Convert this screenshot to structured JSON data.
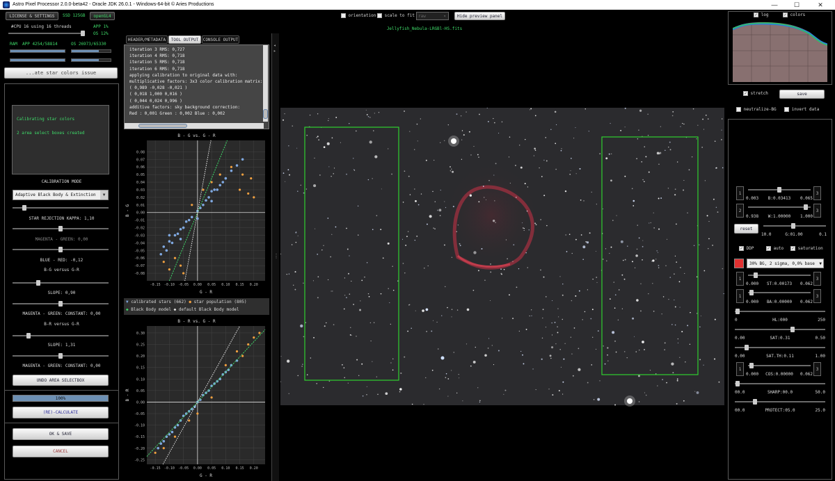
{
  "window": {
    "title": "Astro Pixel Processor 2.0.0-beta42 - Oracle JDK 26.0.1 - Windows-64-bit © Aries Productions"
  },
  "top_left": {
    "license_button": "LICENSE & SETTINGS",
    "ssd": "SSD 125GB",
    "opengl": "openGL4",
    "cpu_text": "#CPU 16  using 16 threads",
    "app_pct": "APP 1%",
    "os_pct": "OS 12%",
    "ram_label": "RAM",
    "ram_app": "APP 4254/58814",
    "ram_os": "OS 26973/65330",
    "task_button": "...ate star colors issue"
  },
  "left_panel": {
    "message_lines": [
      "Calibrating star colors",
      "2 area select boxes created"
    ],
    "calibration_mode_label": "CALIBRATION MODE",
    "calibration_mode_value": "Adaptive Black Body & Extinction",
    "star_rejection": "STAR REJECTION KAPPA: 1,10",
    "magenta_green": "MAGENTA - GREEN: 0,00",
    "blue_red": "BLUE - RED: -0,12",
    "bg_vs_gr": "B-G versus G-R",
    "slope1": "SLOPE: 0,90",
    "mg_constant1": "MAGENTA - GREEN: CONSTANT: 0,00",
    "br_vs_gr": "B-R versus G-R",
    "slope2": "SLOPE: 1,31",
    "mg_constant2": "MAGENTA - GREEN: CONSTANT: 0,00",
    "undo_button": "UNDO AREA SELECTBOX",
    "progress_text": "100%",
    "progress": 1.0,
    "recalculate_button": "(RE)-CALCULATE",
    "ok_save_button": "OK & SAVE",
    "cancel_button": "CANCEL"
  },
  "tabs": [
    "HEADER/METADATA",
    "TOOL OUTPUT",
    "CONSOLE OUTPUT"
  ],
  "console_lines": [
    "iteration 3 RMS: 0,727",
    "iteration 4 RMS: 0,718",
    "iteration 5 RMS: 0,718",
    "iteration 6 RMS: 0,718",
    "applying calibration to original data with:",
    "multiplicative factors: 3x3 color calibration matrix:",
    "( 0,989 -0,028 -0,021 )",
    "( 0,018 1,000 0,016 )",
    "( 0,044 0,024 0,996 )",
    "additive factors: sky background correction:",
    "Red   : 0,001 Green : 0,002 Blue  : 0,002"
  ],
  "legend": {
    "calibrated": "calibrated stars (662)",
    "population": "star population (805)",
    "bb_model": "Black Body model",
    "default_bb": "default Black Body model"
  },
  "toolbar": {
    "orientation": "orientation",
    "scale_to_fit": "scale to fit",
    "dropdown": "raw",
    "hide_preview": "Hide preview panel",
    "filename": "Jellyfish_Nebula-LRGBl-HS.fits"
  },
  "right_panel": {
    "log": "log",
    "colors": "colors",
    "stretch": "stretch",
    "save": "save",
    "neutralize_bg": "neutralize-BG",
    "invert_data": "invert data",
    "b_left": "0.003",
    "b_label": "B:0.03413",
    "b_right": "0.065",
    "w_left": "0.938",
    "w_label": "W:1.00000",
    "w_right": "1.000",
    "reset": "reset",
    "g_left": "10.0",
    "g_label": "G:01.00",
    "g_right": "0.1",
    "ddp": "DDP",
    "auto": "auto",
    "saturation": "saturation",
    "stretch_mode": "30% BG, 2 sigma, 0,0% base",
    "st_left": "0.000",
    "st_label": "ST:0.00173",
    "st_right": "0.062",
    "ba_left": "0.000",
    "ba_label": "BA:0.00000",
    "ba_right": "0.062",
    "hl_left": "0",
    "hl_label": "HL:000",
    "hl_right": "250",
    "sat_left": "0.00",
    "sat_label": "SAT:0.31",
    "sat_right": "0.50",
    "satth_left": "0.00",
    "satth_label": "SAT.TH:0.11",
    "satth_right": "1.00",
    "cos_left": "0.000",
    "cos_label": "COS:0.00000",
    "cos_right": "0.062",
    "sharp_left": "00.0",
    "sharp_label": "SHARP:00.0",
    "sharp_right": "50.0",
    "protect_left": "00.0",
    "protect_label": "PROTECT:05.0",
    "protect_right": "25.0",
    "btn1": "1",
    "btn2": "2",
    "btn3": "3"
  },
  "colors": {
    "green_box": "#2fd02f",
    "scatter_blue": "#7fa8e0",
    "scatter_orange": "#f0a040"
  },
  "chart_data": [
    {
      "type": "scatter",
      "title": "B - G  vs.  G - R",
      "xlabel": "G - R",
      "ylabel": "B - G",
      "xlim": [
        -0.18,
        0.24
      ],
      "ylim": [
        -0.09,
        0.095
      ],
      "xticks": [
        "-0.15",
        "-0.10",
        "-0.05",
        "0.00",
        "0.05",
        "0.10",
        "0.15",
        "0.20"
      ],
      "yticks": [
        "0.08",
        "0.07",
        "0.06",
        "0.05",
        "0.04",
        "0.03",
        "0.02",
        "0.01",
        "0.00",
        "-0.01",
        "-0.02",
        "-0.03",
        "-0.04",
        "-0.05",
        "-0.06",
        "-0.07",
        "-0.08"
      ],
      "model_slope": 0.9,
      "default_model_slope": 2.0,
      "series": [
        {
          "name": "calibrated stars (662)",
          "points": [
            [
              -0.12,
              -0.045
            ],
            [
              -0.1,
              -0.038
            ],
            [
              -0.08,
              -0.03
            ],
            [
              -0.06,
              -0.022
            ],
            [
              -0.05,
              -0.02
            ],
            [
              -0.04,
              -0.012
            ],
            [
              -0.02,
              -0.006
            ],
            [
              0.0,
              0.002
            ],
            [
              0.02,
              0.01
            ],
            [
              0.04,
              0.02
            ],
            [
              0.06,
              0.03
            ],
            [
              0.08,
              0.036
            ],
            [
              0.1,
              0.045
            ],
            [
              0.12,
              0.055
            ],
            [
              0.14,
              0.062
            ],
            [
              0.16,
              0.07
            ],
            [
              -0.11,
              -0.05
            ],
            [
              -0.09,
              -0.04
            ],
            [
              -0.07,
              -0.028
            ],
            [
              -0.03,
              -0.01
            ],
            [
              0.01,
              0.006
            ],
            [
              0.03,
              0.016
            ],
            [
              0.05,
              0.028
            ],
            [
              0.07,
              0.03
            ],
            [
              0.09,
              0.04
            ],
            [
              -0.13,
              -0.055
            ],
            [
              -0.1,
              -0.03
            ],
            [
              -0.06,
              -0.035
            ],
            [
              0.0,
              -0.008
            ],
            [
              0.05,
              0.015
            ]
          ]
        },
        {
          "name": "star population (805)",
          "points": [
            [
              -0.08,
              -0.06
            ],
            [
              -0.06,
              -0.07
            ],
            [
              -0.1,
              -0.075
            ],
            [
              0.15,
              0.03
            ],
            [
              0.18,
              0.025
            ],
            [
              0.2,
              0.02
            ],
            [
              0.05,
              0.04
            ],
            [
              0.02,
              0.03
            ],
            [
              -0.02,
              0.01
            ],
            [
              0.12,
              0.06
            ],
            [
              0.16,
              0.05
            ],
            [
              -0.05,
              -0.08
            ],
            [
              0.19,
              0.045
            ],
            [
              0.08,
              0.05
            ],
            [
              -0.12,
              -0.065
            ]
          ]
        }
      ]
    },
    {
      "type": "scatter",
      "title": "B - R  vs.  G - R",
      "xlabel": "G - R",
      "ylabel": "B - R",
      "xlim": [
        -0.18,
        0.24
      ],
      "ylim": [
        -0.27,
        0.33
      ],
      "xticks": [
        "-0.15",
        "-0.10",
        "-0.05",
        "0.00",
        "0.05",
        "0.10",
        "0.15",
        "0.20"
      ],
      "yticks": [
        "0.30",
        "0.25",
        "0.20",
        "0.15",
        "0.10",
        "0.05",
        "0.00",
        "-0.05",
        "-0.10",
        "-0.15",
        "-0.20",
        "-0.25"
      ],
      "model_slope": 1.31,
      "default_model_slope": 2.2,
      "series": [
        {
          "name": "calibrated stars (662)",
          "points": [
            [
              -0.14,
              -0.2
            ],
            [
              -0.12,
              -0.17
            ],
            [
              -0.1,
              -0.14
            ],
            [
              -0.08,
              -0.11
            ],
            [
              -0.06,
              -0.08
            ],
            [
              -0.04,
              -0.05
            ],
            [
              -0.02,
              -0.03
            ],
            [
              0.0,
              0.0
            ],
            [
              0.02,
              0.03
            ],
            [
              0.04,
              0.05
            ],
            [
              0.06,
              0.08
            ],
            [
              0.08,
              0.1
            ],
            [
              0.1,
              0.13
            ],
            [
              0.12,
              0.16
            ],
            [
              0.14,
              0.18
            ],
            [
              -0.13,
              -0.18
            ],
            [
              -0.09,
              -0.13
            ],
            [
              -0.07,
              -0.1
            ],
            [
              -0.03,
              -0.04
            ],
            [
              0.01,
              0.01
            ],
            [
              0.03,
              0.04
            ],
            [
              0.05,
              0.07
            ],
            [
              0.07,
              0.09
            ],
            [
              0.09,
              0.12
            ],
            [
              -0.11,
              -0.15
            ],
            [
              -0.05,
              -0.06
            ],
            [
              -0.01,
              -0.02
            ],
            [
              0.11,
              0.14
            ]
          ]
        },
        {
          "name": "star population (805)",
          "points": [
            [
              0.18,
              0.25
            ],
            [
              0.2,
              0.28
            ],
            [
              0.16,
              0.2
            ],
            [
              -0.15,
              -0.22
            ],
            [
              -0.12,
              -0.2
            ],
            [
              0.0,
              -0.05
            ],
            [
              0.05,
              0.02
            ],
            [
              0.1,
              0.16
            ],
            [
              -0.08,
              -0.15
            ],
            [
              0.14,
              0.22
            ],
            [
              -0.03,
              -0.08
            ],
            [
              0.22,
              0.3
            ]
          ]
        }
      ]
    }
  ]
}
